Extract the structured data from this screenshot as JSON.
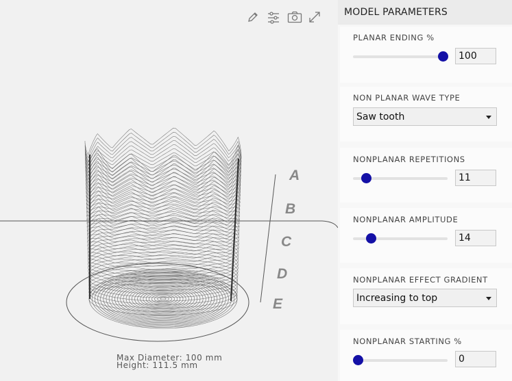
{
  "panel": {
    "title": "MODEL PARAMETERS",
    "params": [
      {
        "label": "PLANAR ENDING %",
        "kind": "slider",
        "value": "100",
        "min": 0,
        "max": 100,
        "fraction": 1.0
      },
      {
        "label": "NON PLANAR WAVE TYPE",
        "kind": "select",
        "value": "Saw tooth"
      },
      {
        "label": "NONPLANAR REPETITIONS",
        "kind": "slider",
        "value": "11",
        "min": 10,
        "max": 100,
        "fraction": 0.1
      },
      {
        "label": "NONPLANAR AMPLITUDE",
        "kind": "slider",
        "value": "14",
        "min": 10,
        "max": 100,
        "fraction": 0.15
      },
      {
        "label": "NONPLANAR EFFECT GRADIENT",
        "kind": "select",
        "value": "Increasing to top"
      },
      {
        "label": "NONPLANAR STARTING %",
        "kind": "slider",
        "value": "0",
        "min": 0,
        "max": 100,
        "fraction": 0.0
      }
    ]
  },
  "toolbar": {
    "icons": [
      "pencil-icon",
      "sliders-icon",
      "camera-icon",
      "expand-icon"
    ]
  },
  "viewport": {
    "letters": [
      "A",
      "B",
      "C",
      "D",
      "E"
    ],
    "dimensions": {
      "diameter": "Max Diameter: 100 mm",
      "height": "Height: 111.5 mm"
    },
    "sawtooth_peaks": 11,
    "layers": 42
  },
  "colors": {
    "accent": "#1410a6",
    "wire": "#555555"
  }
}
